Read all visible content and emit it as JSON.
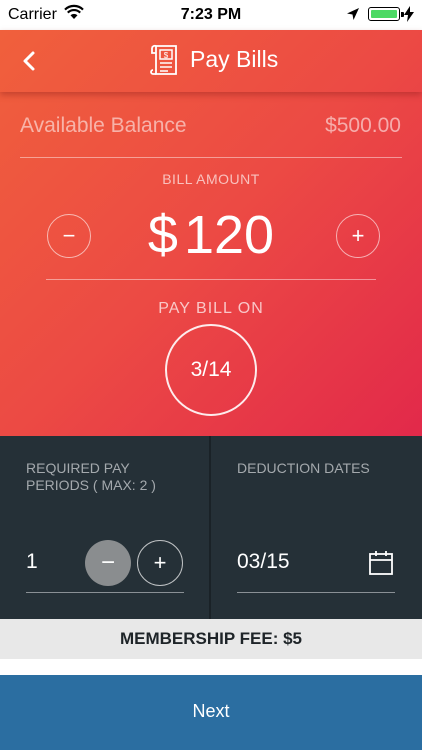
{
  "status_bar": {
    "carrier": "Carrier",
    "time": "7:23 PM",
    "battery_color": "#4cd964"
  },
  "header": {
    "title": "Pay Bills",
    "back_icon": "chevron-left-icon",
    "title_icon": "bill-receipt-icon"
  },
  "balance": {
    "label": "Available Balance",
    "value": "$500.00"
  },
  "bill_amount": {
    "label": "BILL AMOUNT",
    "currency": "$",
    "value": "120",
    "minus": "−",
    "plus": "+"
  },
  "pay_bill_on": {
    "label": "PAY BILL ON",
    "date": "3/14"
  },
  "pay_periods": {
    "label": "REQUIRED PAY PERIODS ( MAX: 2 )",
    "value": "1",
    "minus": "−",
    "plus": "+"
  },
  "deduction_dates": {
    "label": "DEDUCTION DATES",
    "value": "03/15",
    "icon": "calendar-icon"
  },
  "membership_fee": "MEMBERSHIP FEE: $5",
  "next_button": "Next",
  "colors": {
    "gradient_start": "#f0603c",
    "gradient_end": "#e2294a",
    "panel_bg": "#253037",
    "next_bg": "#2b6ea1"
  }
}
